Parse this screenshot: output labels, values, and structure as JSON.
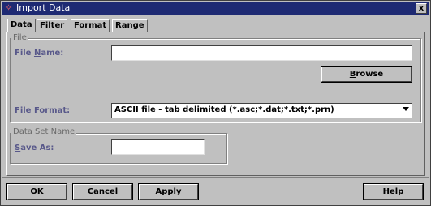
{
  "window": {
    "title": "Import Data",
    "close_glyph": "x"
  },
  "tabs": [
    {
      "label": "Data",
      "active": true
    },
    {
      "label": "Filter",
      "active": false
    },
    {
      "label": "Format",
      "active": false
    },
    {
      "label": "Range",
      "active": false
    }
  ],
  "file_group": {
    "title": "File",
    "file_name_label": "File Name:",
    "file_name_value": "",
    "browse_label": "Browse",
    "file_format_label": "File Format:",
    "file_format_value": "ASCII file - tab delimited (*.asc;*.dat;*.txt;*.prn)"
  },
  "dataset_group": {
    "title": "Data Set Name",
    "save_as_label": "Save As:",
    "save_as_value": ""
  },
  "buttons": {
    "ok": "OK",
    "cancel": "Cancel",
    "apply": "Apply",
    "help": "Help"
  },
  "colors": {
    "titlebar": "#1e2a73",
    "label": "#58588a",
    "background": "#c0c0c0"
  }
}
